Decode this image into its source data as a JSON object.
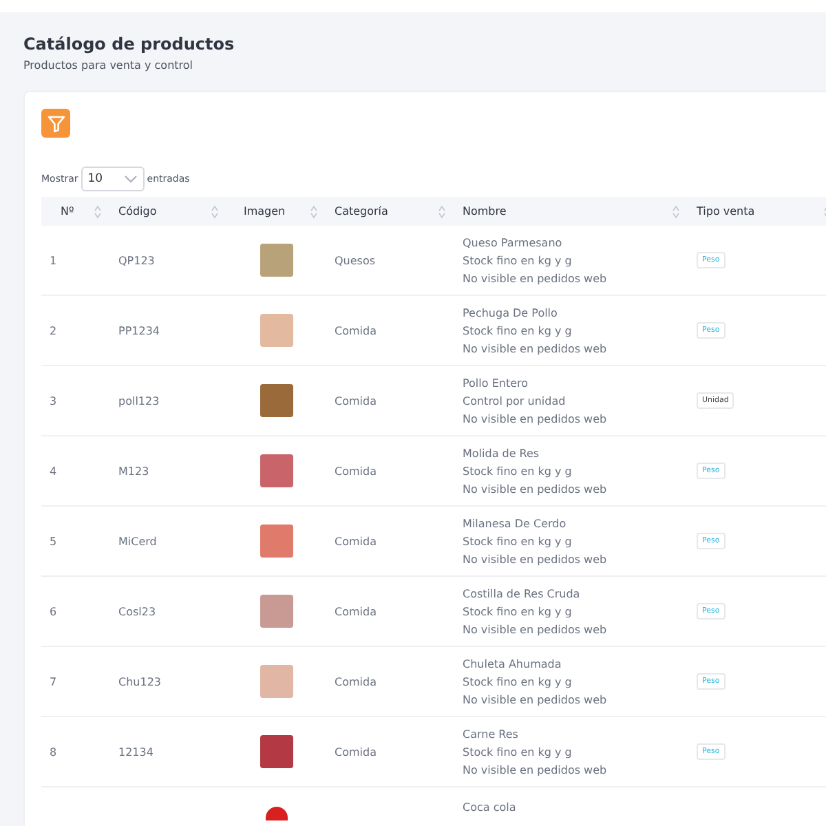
{
  "header": {
    "title": "Catálogo de productos",
    "subtitle": "Productos para venta y control"
  },
  "length_menu": {
    "label_before": "Mostrar",
    "value": "10",
    "label_after": "entradas"
  },
  "table": {
    "columns": [
      "Nº",
      "Código",
      "Imagen",
      "Categoría",
      "Nombre",
      "Tipo venta"
    ],
    "rows": [
      {
        "number": "1",
        "code": "QP123",
        "category": "Quesos",
        "name": [
          "Queso Parmesano",
          "Stock fino en kg y g",
          "No visible en pedidos web"
        ],
        "sale_type": {
          "kind": "peso",
          "label": "Peso"
        }
      },
      {
        "number": "2",
        "code": "PP1234",
        "category": "Comida",
        "name": [
          "Pechuga De Pollo",
          "Stock fino en kg y g",
          "No visible en pedidos web"
        ],
        "sale_type": {
          "kind": "peso",
          "label": "Peso"
        }
      },
      {
        "number": "3",
        "code": "poll123",
        "category": "Comida",
        "name": [
          "Pollo Entero",
          "Control por unidad",
          "No visible en pedidos web"
        ],
        "sale_type": {
          "kind": "unidad",
          "label": "Unidad"
        }
      },
      {
        "number": "4",
        "code": "M123",
        "category": "Comida",
        "name": [
          "Molida de Res",
          "Stock fino en kg y g",
          "No visible en pedidos web"
        ],
        "sale_type": {
          "kind": "peso",
          "label": "Peso"
        }
      },
      {
        "number": "5",
        "code": "MiCerd",
        "category": "Comida",
        "name": [
          "Milanesa De Cerdo",
          "Stock fino en kg y g",
          "No visible en pedidos web"
        ],
        "sale_type": {
          "kind": "peso",
          "label": "Peso"
        }
      },
      {
        "number": "6",
        "code": "Cosl23",
        "category": "Comida",
        "name": [
          "Costilla de Res Cruda",
          "Stock fino en kg y g",
          "No visible en pedidos web"
        ],
        "sale_type": {
          "kind": "peso",
          "label": "Peso"
        }
      },
      {
        "number": "7",
        "code": "Chu123",
        "category": "Comida",
        "name": [
          "Chuleta Ahumada",
          "Stock fino en kg y g",
          "No visible en pedidos web"
        ],
        "sale_type": {
          "kind": "peso",
          "label": "Peso"
        }
      },
      {
        "number": "8",
        "code": "12134",
        "category": "Comida",
        "name": [
          "Carne Res",
          "Stock fino en kg y g",
          "No visible en pedidos web"
        ],
        "sale_type": {
          "kind": "peso",
          "label": "Peso"
        }
      },
      {
        "name": [
          "Coca cola"
        ]
      }
    ]
  }
}
